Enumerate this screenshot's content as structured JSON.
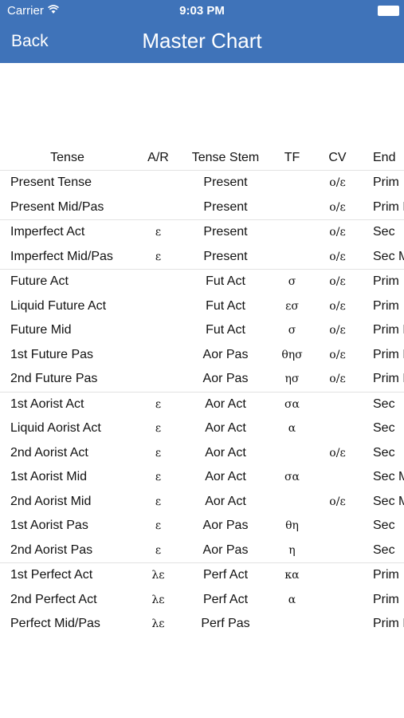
{
  "status_bar": {
    "carrier": "Carrier",
    "time": "9:03 PM"
  },
  "nav": {
    "back_label": "Back",
    "title": "Master Chart"
  },
  "table": {
    "headers": [
      "Tense",
      "A/R",
      "Tense Stem",
      "TF",
      "CV",
      "End"
    ],
    "rows": [
      {
        "tense": "Present Tense",
        "ar": "",
        "stem": "Present",
        "tf": "",
        "cv": "o/ε",
        "end": "Prim",
        "sep": false
      },
      {
        "tense": "Present Mid/Pas",
        "ar": "",
        "stem": "Present",
        "tf": "",
        "cv": "o/ε",
        "end": "Prim M",
        "sep": false
      },
      {
        "tense": "Imperfect Act",
        "ar": "ε",
        "stem": "Present",
        "tf": "",
        "cv": "o/ε",
        "end": "Sec",
        "sep": true
      },
      {
        "tense": "Imperfect Mid/Pas",
        "ar": "ε",
        "stem": "Present",
        "tf": "",
        "cv": "o/ε",
        "end": "Sec M",
        "sep": false
      },
      {
        "tense": "Future Act",
        "ar": "",
        "stem": "Fut Act",
        "tf": "σ",
        "cv": "o/ε",
        "end": "Prim",
        "sep": true
      },
      {
        "tense": "Liquid Future Act",
        "ar": "",
        "stem": "Fut Act",
        "tf": "εσ",
        "cv": "o/ε",
        "end": "Prim",
        "sep": false
      },
      {
        "tense": "Future Mid",
        "ar": "",
        "stem": "Fut Act",
        "tf": "σ",
        "cv": "o/ε",
        "end": "Prim M",
        "sep": false
      },
      {
        "tense": "1st Future Pas",
        "ar": "",
        "stem": "Aor Pas",
        "tf": "θησ",
        "cv": "o/ε",
        "end": "Prim M",
        "sep": false
      },
      {
        "tense": "2nd Future Pas",
        "ar": "",
        "stem": "Aor Pas",
        "tf": "ησ",
        "cv": "o/ε",
        "end": "Prim M",
        "sep": false
      },
      {
        "tense": "1st Aorist Act",
        "ar": "ε",
        "stem": "Aor Act",
        "tf": "σα",
        "cv": "",
        "end": "Sec",
        "sep": true
      },
      {
        "tense": "Liquid Aorist Act",
        "ar": "ε",
        "stem": "Aor Act",
        "tf": "α",
        "cv": "",
        "end": "Sec",
        "sep": false
      },
      {
        "tense": "2nd Aorist Act",
        "ar": "ε",
        "stem": "Aor Act",
        "tf": "",
        "cv": "o/ε",
        "end": "Sec",
        "sep": false
      },
      {
        "tense": "1st Aorist Mid",
        "ar": "ε",
        "stem": "Aor Act",
        "tf": "σα",
        "cv": "",
        "end": "Sec M",
        "sep": false
      },
      {
        "tense": "2nd Aorist Mid",
        "ar": "ε",
        "stem": "Aor Act",
        "tf": "",
        "cv": "o/ε",
        "end": "Sec M",
        "sep": false
      },
      {
        "tense": "1st Aorist Pas",
        "ar": "ε",
        "stem": "Aor Pas",
        "tf": "θη",
        "cv": "",
        "end": "Sec",
        "sep": false
      },
      {
        "tense": "2nd Aorist Pas",
        "ar": "ε",
        "stem": "Aor Pas",
        "tf": "η",
        "cv": "",
        "end": "Sec",
        "sep": false
      },
      {
        "tense": "1st Perfect Act",
        "ar": "λε",
        "stem": "Perf Act",
        "tf": "κα",
        "cv": "",
        "end": "Prim",
        "sep": true
      },
      {
        "tense": "2nd Perfect Act",
        "ar": "λε",
        "stem": "Perf Act",
        "tf": "α",
        "cv": "",
        "end": "Prim",
        "sep": false
      },
      {
        "tense": "Perfect Mid/Pas",
        "ar": "λε",
        "stem": "Perf Pas",
        "tf": "",
        "cv": "",
        "end": "Prim M",
        "sep": false
      }
    ]
  }
}
